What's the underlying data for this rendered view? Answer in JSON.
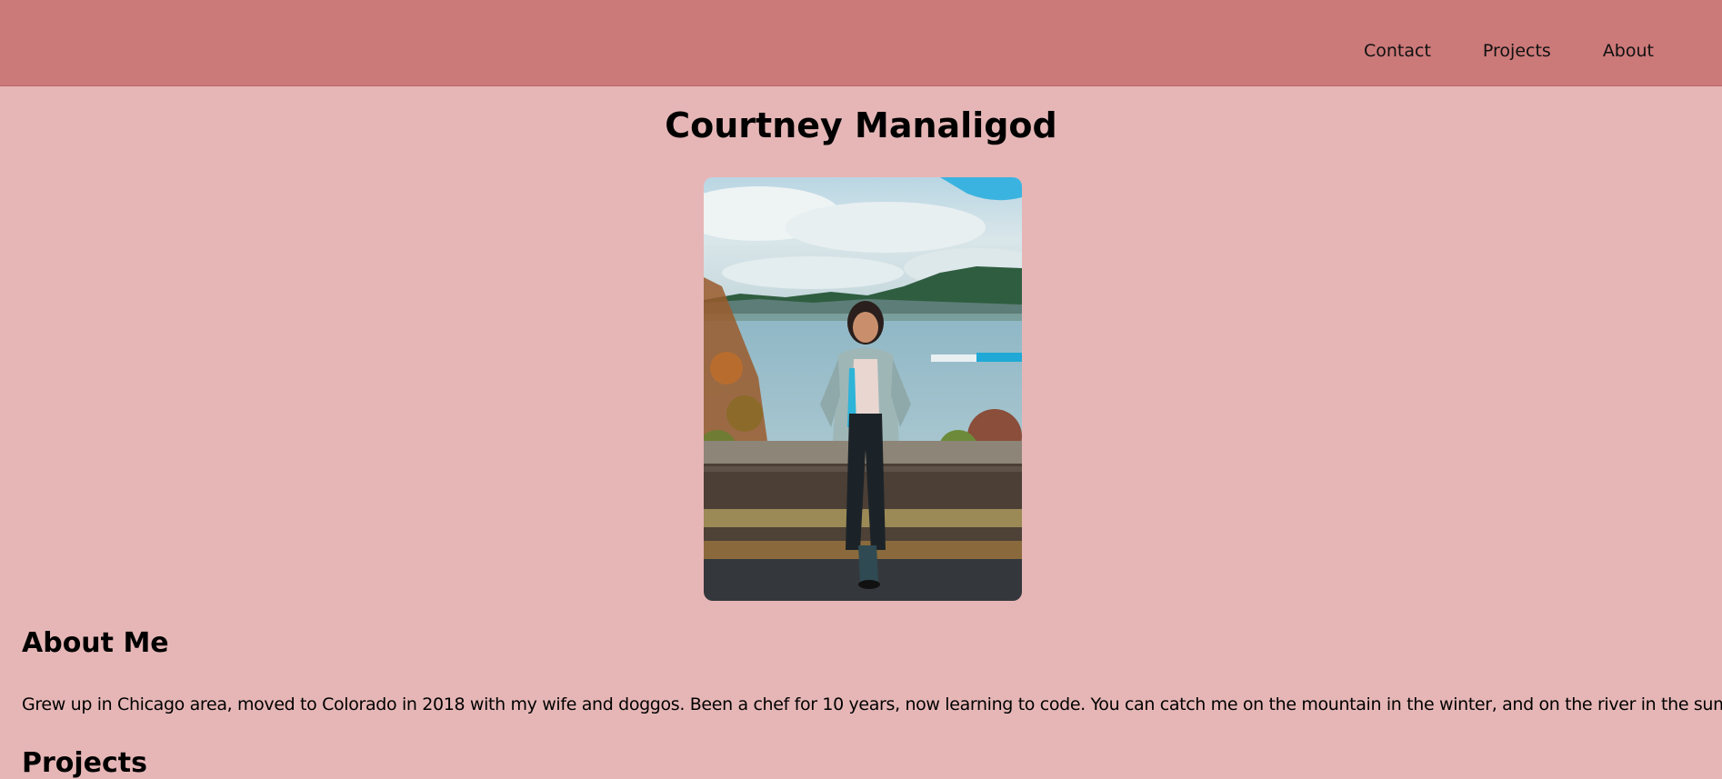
{
  "nav": {
    "items": [
      {
        "label": "Contact"
      },
      {
        "label": "Projects"
      },
      {
        "label": "About"
      }
    ]
  },
  "page_title": "Courtney Manaligod",
  "about": {
    "heading": "About Me",
    "text": "Grew up in Chicago area, moved to Colorado in 2018 with my wife and doggos. Been a chef for 10 years, now learning to code. You can catch me on the mountain in the winter, and on the river in the summer!"
  },
  "projects": {
    "heading": "Projects"
  },
  "colors": {
    "header_bg": "#cc7979",
    "page_bg": "#e6b6b6"
  }
}
